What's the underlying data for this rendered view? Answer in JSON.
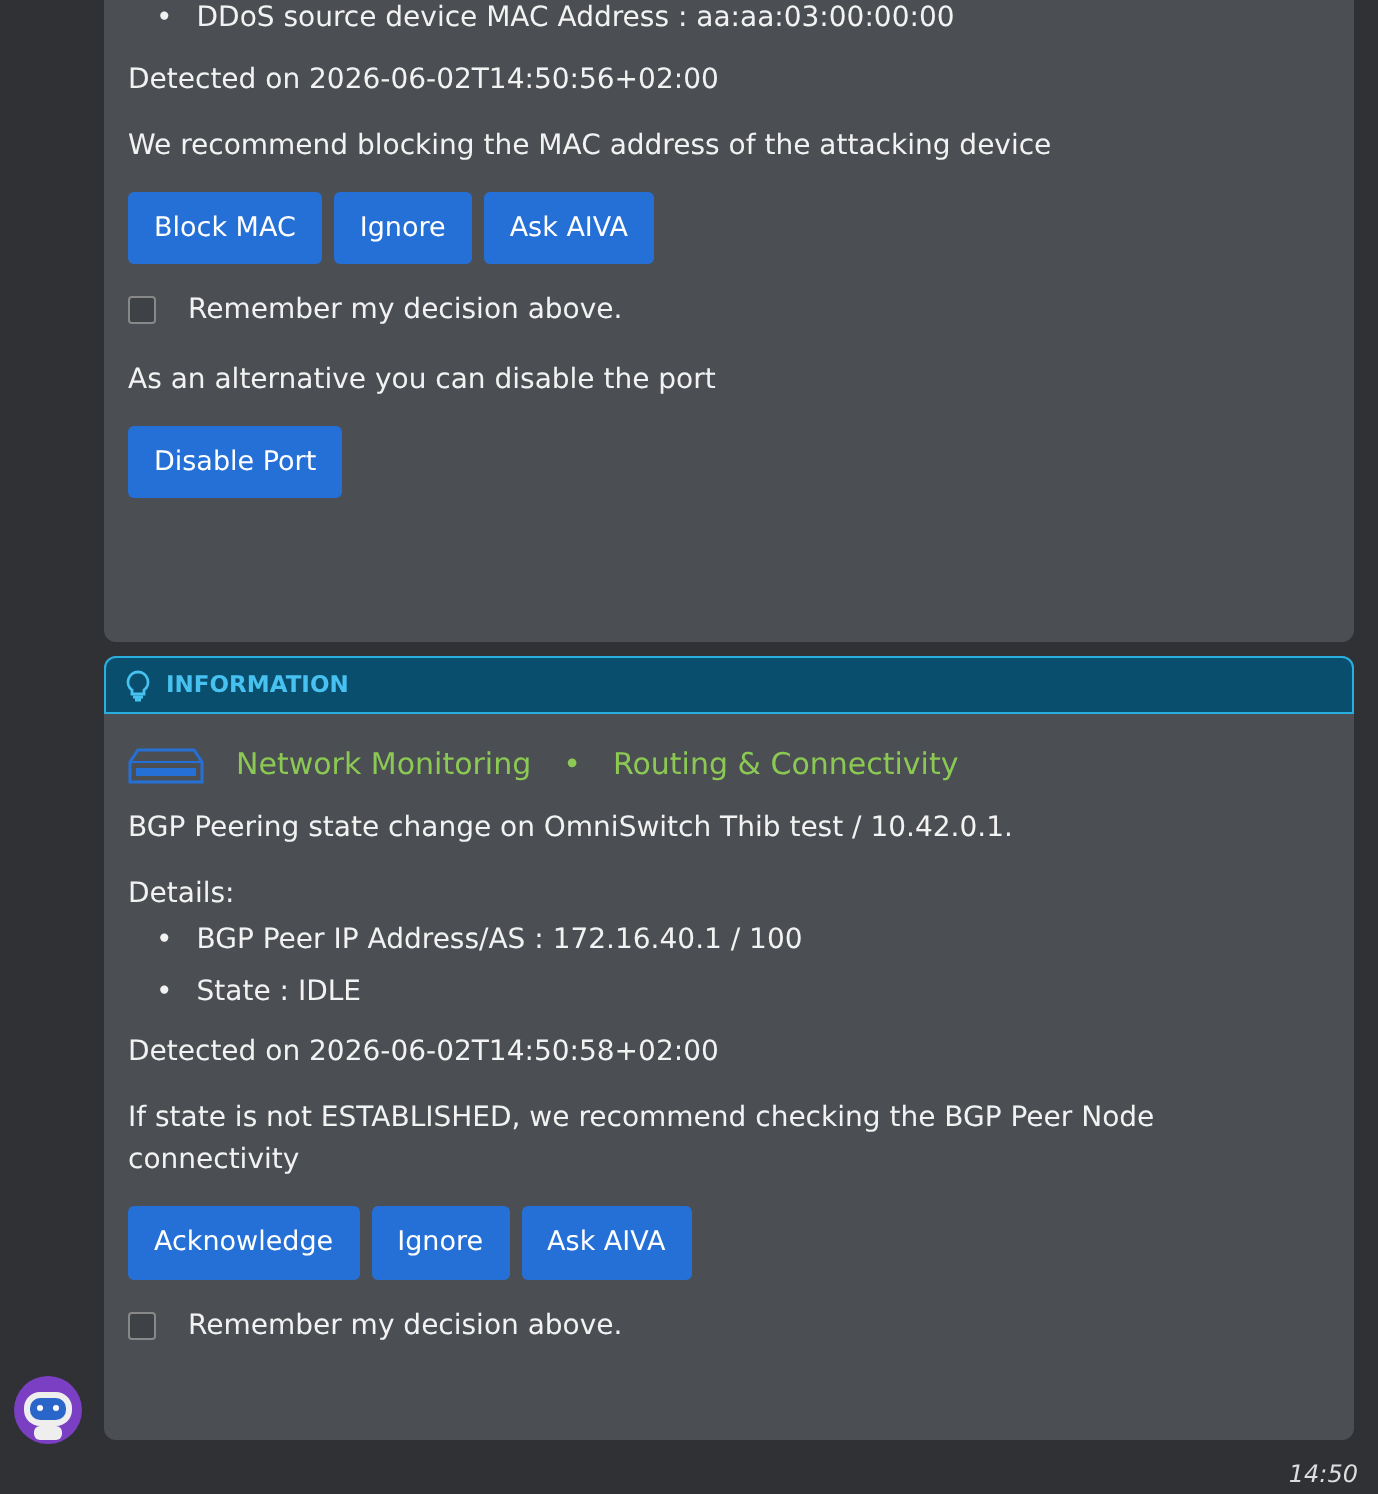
{
  "messages": [
    {
      "details": [
        {
          "bullet": "•",
          "text": "DDoS source device MAC Address : aa:aa:03:00:00:00"
        }
      ],
      "detected": "Detected on 2026-06-02T14:50:56+02:00",
      "recommendation": "We recommend blocking the MAC address of the attacking device",
      "buttons": [
        "Block MAC",
        "Ignore",
        "Ask AIVA"
      ],
      "remember": {
        "label": "Remember my decision above.",
        "checked": false
      },
      "alternative": "As an alternative you can disable the port",
      "alt_buttons": [
        "Disable Port"
      ]
    },
    {
      "header": "INFORMATION",
      "categories": [
        "Network Monitoring",
        "Routing & Connectivity"
      ],
      "separator": "•",
      "summary": "BGP Peering state change on OmniSwitch Thib test / 10.42.0.1.",
      "details_label": "Details:",
      "details": [
        {
          "bullet": "•",
          "text": "BGP Peer IP Address/AS : 172.16.40.1 / 100"
        },
        {
          "bullet": "•",
          "text": "State : IDLE"
        }
      ],
      "detected": "Detected on 2026-06-02T14:50:58+02:00",
      "recommendation": "If state is not ESTABLISHED, we recommend checking the BGP Peer Node connectivity",
      "buttons": [
        "Acknowledge",
        "Ignore",
        "Ask AIVA"
      ],
      "remember": {
        "label": "Remember my decision above.",
        "checked": false
      }
    }
  ],
  "time": "14:50"
}
